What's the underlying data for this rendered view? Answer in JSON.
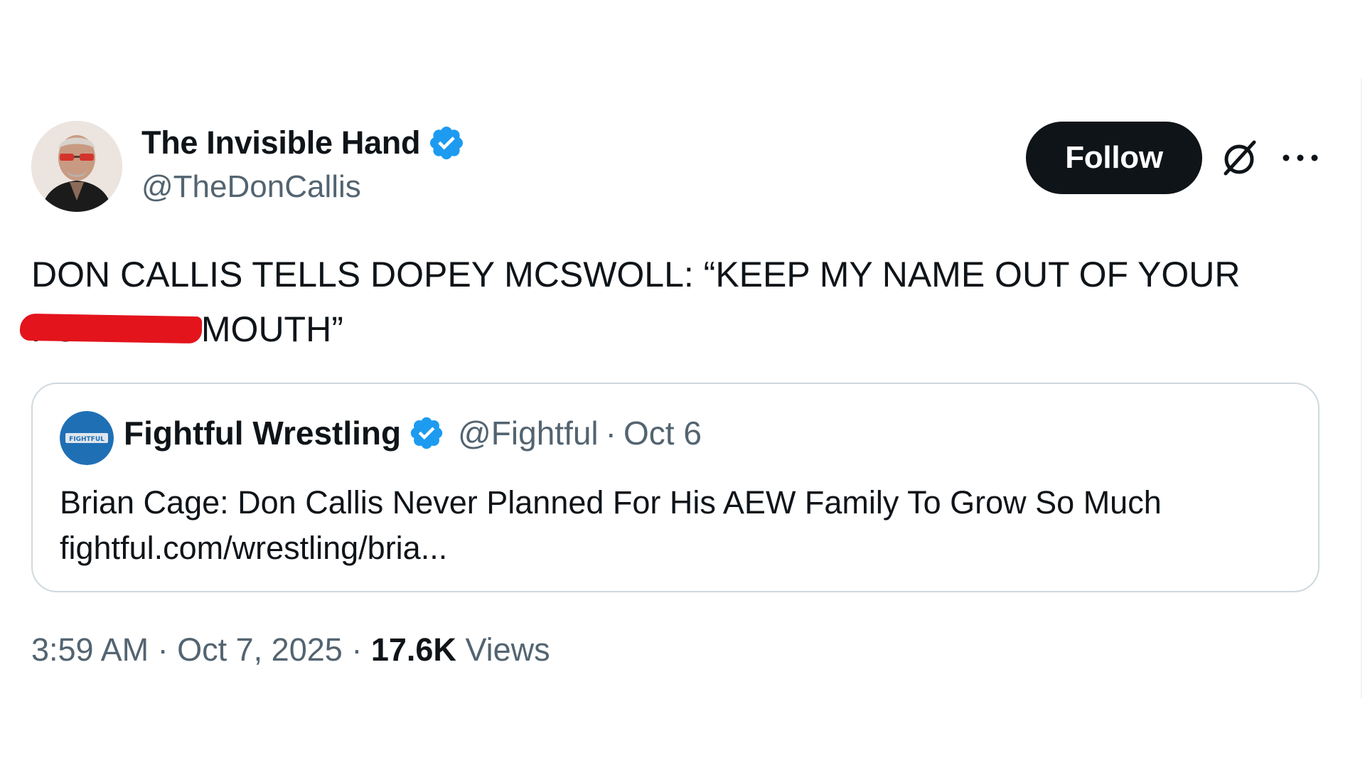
{
  "author": {
    "display_name": "The Invisible Hand",
    "handle": "@TheDonCallis",
    "verified": true,
    "avatar_icon": "profile-photo"
  },
  "follow_button": {
    "label": "Follow"
  },
  "icons": {
    "grok": "grok-icon",
    "more": "more-options-icon",
    "verified": "verified-badge-icon"
  },
  "tweet": {
    "text_line1": "DON CALLIS TELLS DOPEY MCSWOLL: “KEEP MY NAME OUT OF YOUR",
    "censored_word": "FUCKING",
    "text_line2_rest": "MOUTH”"
  },
  "quote": {
    "avatar_text": "FIGHTFUL",
    "display_name": "Fightful Wrestling",
    "handle": "@Fightful",
    "separator": "·",
    "date": "Oct 6",
    "text": "Brian Cage: Don Callis Never Planned For His AEW Family To Grow So Much",
    "link": "fightful.com/wrestling/bria..."
  },
  "footer": {
    "time": "3:59 AM",
    "separator": "·",
    "date": "Oct 7, 2025",
    "views_count": "17.6K",
    "views_label": "Views"
  },
  "colors": {
    "verified_blue": "#1d9bf0",
    "text_primary": "#0f1419",
    "text_secondary": "#536471",
    "border": "#cfd9de",
    "censor_red": "#e3141c",
    "button_black": "#0f1419"
  }
}
